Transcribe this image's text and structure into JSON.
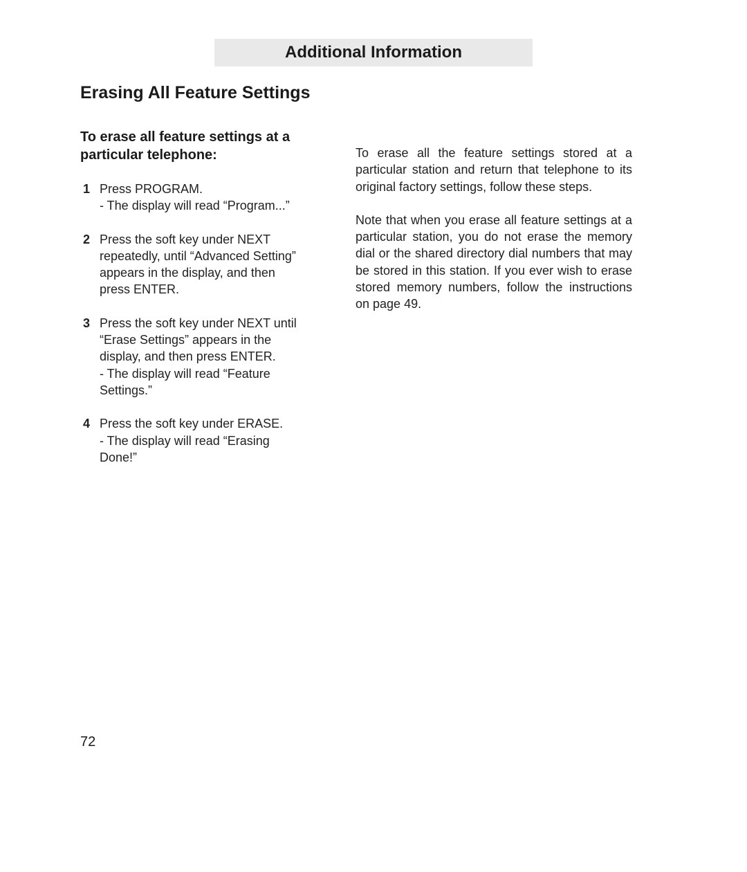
{
  "header": "Additional Information",
  "sectionTitle": "Erasing All Feature Settings",
  "left": {
    "subhead": "To erase all feature settings at a particular telephone:",
    "steps": [
      {
        "num": "1",
        "text": "Press PROGRAM.",
        "note": "- The display will read “Program...”"
      },
      {
        "num": "2",
        "text": "Press the soft key under NEXT repeatedly, until “Advanced Setting” appears in the display, and then press ENTER.",
        "note": ""
      },
      {
        "num": "3",
        "text": "Press the soft key under NEXT until “Erase Settings” appears in the display, and then press ENTER.",
        "note": "- The display will read “Feature Settings.”"
      },
      {
        "num": "4",
        "text": "Press the soft key under ERASE.",
        "note": "- The display will read “Erasing Done!”"
      }
    ]
  },
  "right": {
    "p1": "To erase all the feature settings stored at a particular station and return that telephone to its original factory settings, follow these steps.",
    "p2": "Note that when you erase all feature settings at a particular station, you do not erase the memory dial or the shared directory dial numbers that may be stored in this station.  If you ever wish to erase stored memory numbers, follow the instructions on page 49."
  },
  "pageNumber": "72"
}
